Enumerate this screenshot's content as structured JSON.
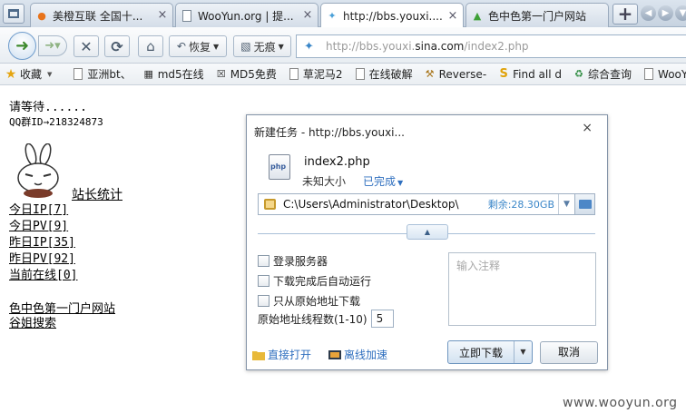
{
  "tabs": [
    {
      "title": "美橙互联 全国十...",
      "icon": "orange-swirl-icon",
      "color": "#e8731a"
    },
    {
      "title": "WooYun.org | 提...",
      "icon": "page-icon",
      "color": "#7a8795"
    },
    {
      "title": "http://bbs.youxi....",
      "icon": "bird-favicon-icon",
      "color": "#4aa0d8"
    },
    {
      "title": "色中色第一门户网站",
      "icon": "tree-favicon-icon",
      "color": "#3ea037"
    }
  ],
  "navbar": {
    "restore_label": "恢复",
    "incognito_label": "无痕",
    "url_prefix": "http://bbs.youxi.",
    "url_domain": "sina.com",
    "url_suffix": "/index2.php"
  },
  "bookmarks": [
    {
      "label": "收藏",
      "icon": "star-icon"
    },
    {
      "label": "亚洲bt、",
      "icon": "page-icon"
    },
    {
      "label": "md5在线",
      "icon": "grid-icon"
    },
    {
      "label": "MD5免费",
      "icon": "x-icon"
    },
    {
      "label": "草泥马2",
      "icon": "page-icon"
    },
    {
      "label": "在线破解",
      "icon": "page-icon"
    },
    {
      "label": "Reverse-",
      "icon": "tool-icon"
    },
    {
      "label": "Find all d",
      "icon": "s-logo-icon"
    },
    {
      "label": "综合查询",
      "icon": "recycle-icon"
    },
    {
      "label": "WooYun",
      "icon": "page-icon"
    }
  ],
  "page": {
    "wait_text": "请等待......",
    "qq_text": "QQ群ID→218324873",
    "stats_title": "站长统计",
    "stats": [
      "今日IP[7]",
      "今日PV[9]",
      "昨日IP[35]",
      "昨日PV[92]",
      "当前在线[0]"
    ],
    "links": [
      "色中色第一门户网站",
      "谷姐搜索"
    ]
  },
  "dialog": {
    "title": "新建任务 - http://bbs.youxi...",
    "close": "×",
    "file_name": "index2.php",
    "file_icon_text": "php",
    "file_size": "未知大小",
    "file_status": "已完成",
    "path": "C:\\Users\\Administrator\\Desktop\\",
    "free_space": "剩余:28.30GB",
    "options": [
      "登录服务器",
      "下载完成后自动运行",
      "只从原始地址下载"
    ],
    "threads_label": "原始地址线程数(1-10)",
    "threads_value": "5",
    "notes_placeholder": "输入注释",
    "open_link": "直接打开",
    "offline_link": "离线加速",
    "download_button": "立即下载",
    "cancel_button": "取消"
  },
  "watermark": "www.wooyun.org"
}
